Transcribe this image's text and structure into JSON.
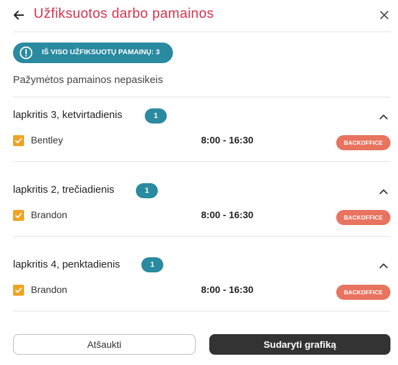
{
  "header": {
    "title": "Užfiksuotos darbo pamainos"
  },
  "summary": {
    "text": "IŠ VISO UŽFIKSUOTŲ PAMAINŲ: 3"
  },
  "note": "Pažymėtos pamainos nepasikeis",
  "days": [
    {
      "title": "lapkritis 3, ketvirtadienis",
      "count": "1",
      "shifts": [
        {
          "name": "Bentley",
          "time": "8:00 - 16:30",
          "role": "BACKOFFICE",
          "checked": true
        }
      ]
    },
    {
      "title": "lapkritis 2, trečiadienis",
      "count": "1",
      "shifts": [
        {
          "name": "Brandon",
          "time": "8:00 - 16:30",
          "role": "BACKOFFICE",
          "checked": true
        }
      ]
    },
    {
      "title": "lapkritis 4, penktadienis",
      "count": "1",
      "shifts": [
        {
          "name": "Brandon",
          "time": "8:00 - 16:30",
          "role": "BACKOFFICE",
          "checked": true
        }
      ]
    }
  ],
  "footer": {
    "cancel_label": "Atšaukti",
    "create_label": "Sudaryti grafiką"
  },
  "colors": {
    "title": "#d6334c",
    "accent_badge": "#2a8aa0",
    "role_badge": "#e8735f",
    "checkbox": "#f0a323",
    "primary_button": "#333333"
  },
  "icons": {
    "back": "arrow-left-icon",
    "close": "close-icon",
    "info": "info-icon",
    "collapse": "chevron-up-icon",
    "check": "checkmark-icon"
  }
}
